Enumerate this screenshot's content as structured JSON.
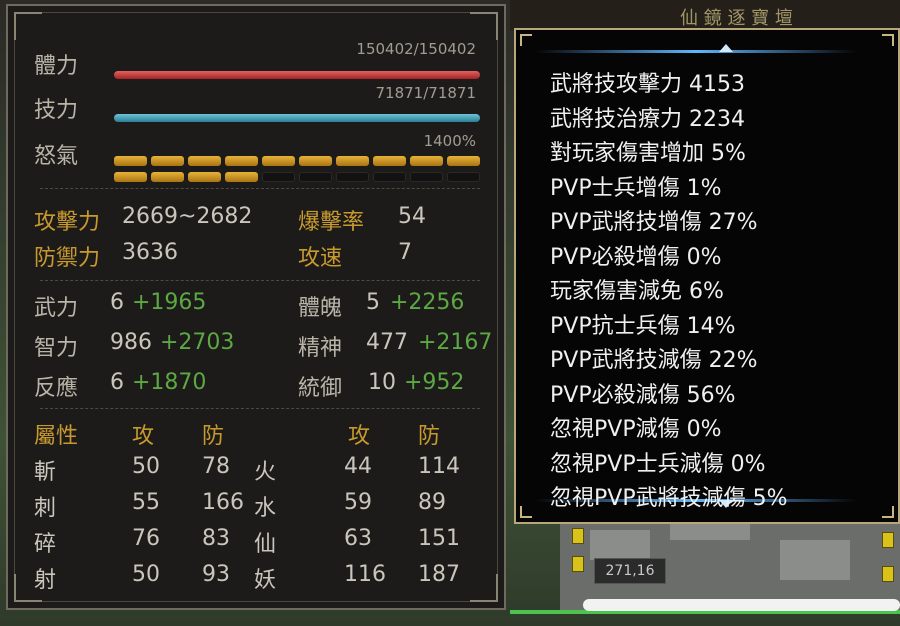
{
  "background": {
    "title_fragment": "仙 鏡 逐 寶 壇",
    "coordinate": "271,16"
  },
  "stats": {
    "hp": {
      "label": "體力",
      "value": "150402/150402",
      "fraction": 1.0
    },
    "mp": {
      "label": "技力",
      "value": "71871/71871",
      "fraction": 1.0
    },
    "rage": {
      "label": "怒氣",
      "value": "1400%",
      "filled_segments": 14,
      "total_segments": 20
    },
    "attack": {
      "label": "攻擊力",
      "value": "2669~2682"
    },
    "defense": {
      "label": "防禦力",
      "value": "3636"
    },
    "crit": {
      "label": "爆擊率",
      "value": "54"
    },
    "speed": {
      "label": "攻速",
      "value": "7"
    },
    "attributes": [
      {
        "label": "武力",
        "base": "6",
        "bonus": "+1965"
      },
      {
        "label": "體魄",
        "base": "5",
        "bonus": "+2256"
      },
      {
        "label": "智力",
        "base": "986",
        "bonus": "+2703"
      },
      {
        "label": "精神",
        "base": "477",
        "bonus": "+2167"
      },
      {
        "label": "反應",
        "base": "6",
        "bonus": "+1870"
      },
      {
        "label": "統御",
        "base": "10",
        "bonus": "+952"
      }
    ],
    "elements_header": {
      "title": "屬性",
      "atk": "攻",
      "def": "防",
      "atk2": "攻",
      "def2": "防"
    },
    "elements": [
      {
        "name": "斬",
        "atk": "50",
        "def": "78",
        "name2": "火",
        "atk2": "44",
        "def2": "114"
      },
      {
        "name": "刺",
        "atk": "55",
        "def": "166",
        "name2": "水",
        "atk2": "59",
        "def2": "89"
      },
      {
        "name": "碎",
        "atk": "76",
        "def": "83",
        "name2": "仙",
        "atk2": "63",
        "def2": "151"
      },
      {
        "name": "射",
        "atk": "50",
        "def": "93",
        "name2": "妖",
        "atk2": "116",
        "def2": "187"
      }
    ]
  },
  "popup": {
    "items": [
      "武將技攻擊力 4153",
      "武將技治療力 2234",
      "對玩家傷害增加 5%",
      "PVP士兵增傷 1%",
      "PVP武將技增傷 27%",
      "PVP必殺增傷 0%",
      "玩家傷害減免 6%",
      "PVP抗士兵傷 14%",
      "PVP武將技減傷 22%",
      "PVP必殺減傷 56%",
      "忽視PVP減傷 0%",
      "忽視PVP士兵減傷 0%",
      "忽視PVP武將技減傷 5%"
    ]
  }
}
